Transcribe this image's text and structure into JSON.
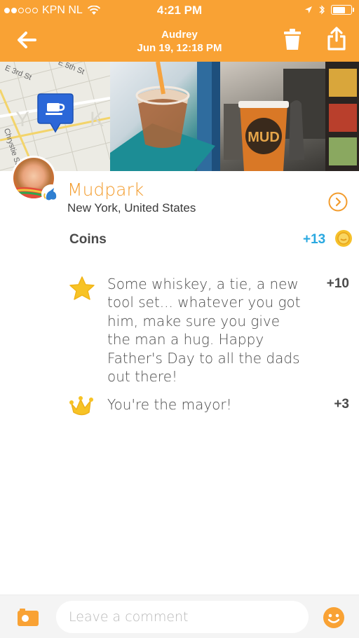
{
  "status": {
    "carrier": "KPN NL",
    "time": "4:21 PM"
  },
  "nav": {
    "user": "Audrey",
    "date": "Jun 19, 12:18 PM"
  },
  "map": {
    "streets": [
      "E 3rd St",
      "E 5th St",
      "Chrystie St"
    ]
  },
  "venue": {
    "name": "Mudpark",
    "location": "New York, United States"
  },
  "coins": {
    "label": "Coins",
    "total": "+13",
    "rows": [
      {
        "icon": "star-icon",
        "text": "Some whiskey, a tie, a new tool set... whatever you got him, make sure you give the man a hug. Happy Father's Day to all the dads out there!",
        "points": "+10"
      },
      {
        "icon": "crown-icon",
        "text": "You're the mayor!",
        "points": "+3"
      }
    ]
  },
  "comment": {
    "placeholder": "Leave a comment"
  },
  "colors": {
    "brand": "#f9a234",
    "accent_blue": "#29a8e0",
    "venue_orange": "#f39c2d",
    "star_yellow": "#f7c325"
  }
}
